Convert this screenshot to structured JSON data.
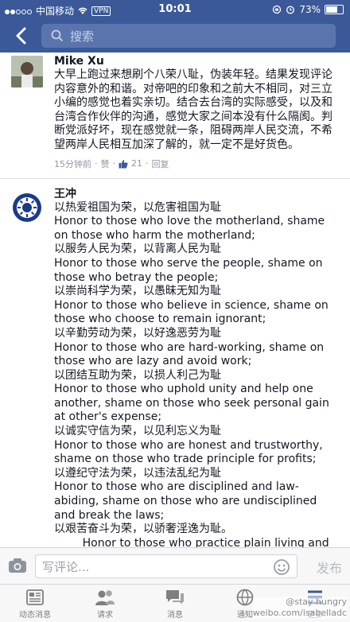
{
  "status_bar": {
    "carrier": "中国移动",
    "vpn": "VPN",
    "time": "10:01",
    "battery": "73%"
  },
  "nav": {
    "search_placeholder": "搜索"
  },
  "comments": [
    {
      "name": "Mike Xu",
      "text": "大早上跑过来想刷个八荣八耻，伪装年轻。结果发现评论内容意外的和谐。对帝吧的印象和之前大不相同，对三立小编的感觉也着实亲切。结合去台湾的实际感受，以及和台湾合作伙伴的沟通，感觉大家之间本没有什么隔阂。判断党派好坏，现在感觉就一条，阻碍两岸人民交流，不希望两岸人民相互加深了解的，就一定不是好货色。",
      "time": "15分钟前",
      "like_label": "赞",
      "likes": "21",
      "reply_label": "回复"
    },
    {
      "name": "王冲",
      "lines": [
        "以热爱祖国为荣，以危害祖国为耻",
        "Honor to those who love the motherland, shame on those who harm the motherland;",
        "以服务人民为荣，以背离人民为耻",
        "Honor to those who serve the people, shame on those who betray the people;",
        "以崇尚科学为荣，以愚昧无知为耻",
        "Honor to those who believe in science, shame on those who choose to remain ignorant;",
        "以辛勤劳动为荣，以好逸恶劳为耻",
        "Honor to those who are hard-working, shame on those who are lazy and avoid work;",
        "以团结互助为荣，以损人利己为耻",
        "Honor to those who uphold unity and help one another, shame on those who seek personal gain at other's expense;",
        "以诚实守信为荣，以见利忘义为耻",
        "Honor to those who are honest and trustworthy, shame on those who trade principle for profits;",
        "以遵纪守法为荣，以违法乱纪为耻",
        "Honor to those who are disciplined and law-abiding, shame on those who are undisciplined and break the laws;",
        "以艰苦奋斗为荣，以骄奢淫逸为耻。",
        "        Honor to those who practice plain living and defy adversity, shame on those who indulge in"
      ]
    }
  ],
  "compose": {
    "placeholder": "写评论...",
    "post_label": "发布"
  },
  "tabs": [
    {
      "label": "动态消息",
      "icon": "news-feed-icon"
    },
    {
      "label": "请求",
      "icon": "friend-requests-icon"
    },
    {
      "label": "消息",
      "icon": "messages-icon"
    },
    {
      "label": "通知",
      "icon": "notifications-icon"
    },
    {
      "label": "更多",
      "icon": "more-icon"
    }
  ],
  "watermark": {
    "handle": "@stay hungry",
    "url": "weibo.com/isabelladc"
  }
}
